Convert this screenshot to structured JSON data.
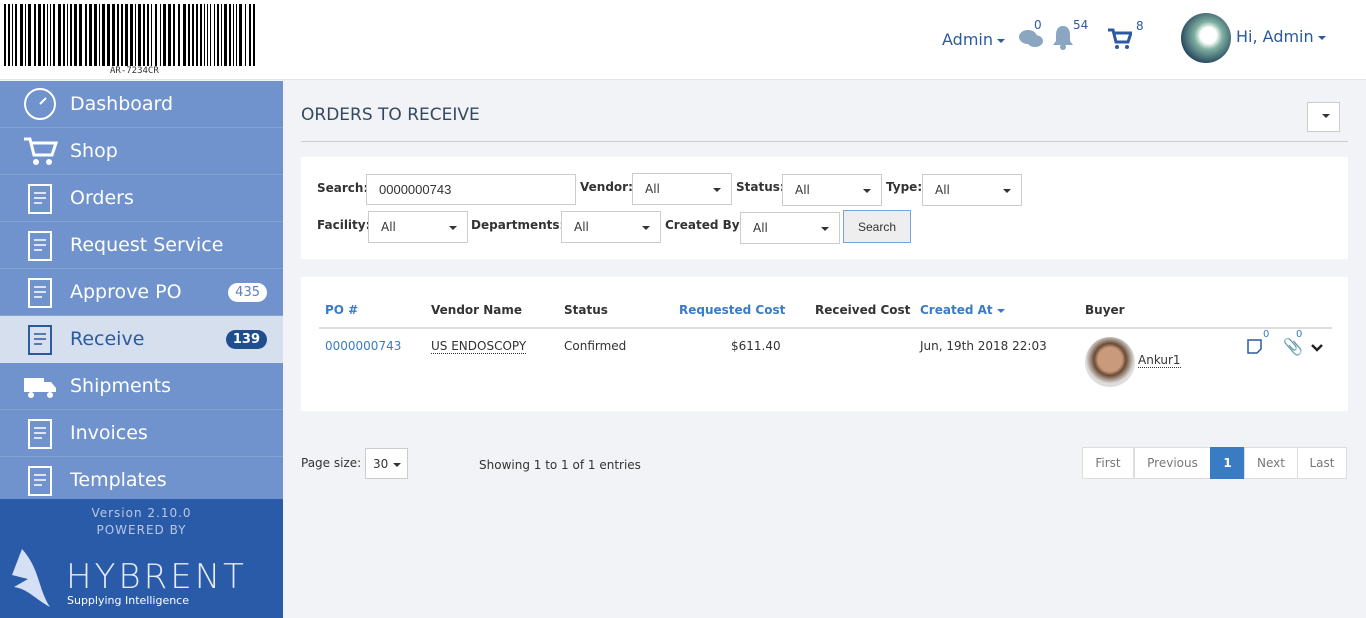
{
  "barcode": {
    "text": "AR-7234CR"
  },
  "header": {
    "role": "Admin",
    "messages_count": "0",
    "notifications_count": "54",
    "cart_count": "8",
    "greeting": "Hi, Admin"
  },
  "sidebar": {
    "items": [
      {
        "label": "Dashboard",
        "icon": "dashboard-icon"
      },
      {
        "label": "Shop",
        "icon": "cart-icon"
      },
      {
        "label": "Orders",
        "icon": "orders-icon"
      },
      {
        "label": "Request Service",
        "icon": "request-service-icon"
      },
      {
        "label": "Approve PO",
        "icon": "approve-icon",
        "badge": "435"
      },
      {
        "label": "Receive",
        "icon": "receive-icon",
        "badge": "139",
        "active": true
      },
      {
        "label": "Shipments",
        "icon": "truck-icon"
      },
      {
        "label": "Invoices",
        "icon": "invoice-icon"
      },
      {
        "label": "Templates",
        "icon": "template-icon"
      }
    ],
    "version": "Version 2.10.0",
    "powered_by": "POWERED BY",
    "brand": "HYBRENT",
    "tagline": "Supplying Intelligence"
  },
  "page": {
    "title": "ORDERS TO RECEIVE"
  },
  "filters": {
    "search_label": "Search:",
    "search_value": "0000000743",
    "vendor_label": "Vendor:",
    "vendor": "All",
    "status_label": "Status:",
    "status": "All",
    "type_label": "Type:",
    "type": "All",
    "facility_label": "Facility:",
    "facility": "All",
    "departments_label": "Departments:",
    "departments": "All",
    "created_by_label": "Created By:",
    "created_by": "All",
    "search_button": "Search"
  },
  "table": {
    "headers": [
      "PO #",
      "Vendor Name",
      "Status",
      "Requested Cost",
      "Received Cost",
      "Created At",
      "Buyer"
    ],
    "rows": [
      {
        "po": "0000000743",
        "vendor": "US ENDOSCOPY",
        "status": "Confirmed",
        "requested_cost": "$611.40",
        "received_cost": "",
        "created_at": "Jun, 19th 2018 22:03",
        "buyer": "Ankur1",
        "notes_count": "0",
        "attachments_count": "0"
      }
    ]
  },
  "footer": {
    "page_size_label": "Page size:",
    "page_size": "30",
    "showing": "Showing 1 to 1 of 1 entries",
    "pagination": [
      "First",
      "Previous",
      "1",
      "Next",
      "Last"
    ]
  },
  "colors": {
    "sidebar": "#7093cd",
    "accent": "#3a7cc4",
    "footer": "#2a5ba9"
  }
}
